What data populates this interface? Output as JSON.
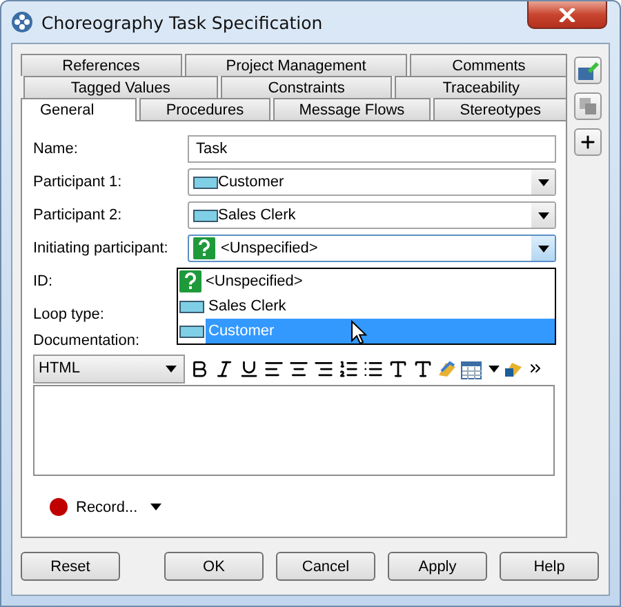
{
  "window": {
    "title": "Choreography Task Specification"
  },
  "tab_rows": [
    [
      {
        "label": "References",
        "selected": false
      },
      {
        "label": "Project Management",
        "selected": false
      },
      {
        "label": "Comments",
        "selected": false
      }
    ],
    [
      {
        "label": "Tagged Values",
        "selected": false
      },
      {
        "label": "Constraints",
        "selected": false
      },
      {
        "label": "Traceability",
        "selected": false
      }
    ],
    [
      {
        "label": "General",
        "selected": true
      },
      {
        "label": "Procedures",
        "selected": false
      },
      {
        "label": "Message Flows",
        "selected": false
      },
      {
        "label": "Stereotypes",
        "selected": false
      }
    ]
  ],
  "fields": [
    {
      "label": "Name:",
      "kind": "text",
      "value": "Task"
    },
    {
      "label": "Participant 1:",
      "kind": "participant",
      "value": "Customer",
      "focused": false
    },
    {
      "label": "Participant 2:",
      "kind": "participant",
      "value": "Sales Clerk",
      "focused": false
    },
    {
      "label": "Initiating participant:",
      "kind": "unspecified",
      "value": "<Unspecified>",
      "focused": true
    },
    {
      "label": "ID:",
      "kind": "covered"
    },
    {
      "label": "Loop type:",
      "kind": "covered"
    }
  ],
  "dropdown": [
    {
      "kind": "unspecified",
      "label": "<Unspecified>",
      "selected": false
    },
    {
      "kind": "participant",
      "label": "Sales Clerk",
      "selected": false
    },
    {
      "kind": "participant",
      "label": "Customer",
      "selected": true
    }
  ],
  "documentation": {
    "label": "Documentation:",
    "format": "HTML"
  },
  "record": {
    "label": "Record..."
  },
  "buttons": [
    {
      "label": "Reset",
      "kind": "left"
    },
    {
      "label": "OK",
      "kind": "right"
    },
    {
      "label": "Cancel",
      "kind": "right"
    },
    {
      "label": "Apply",
      "kind": "right"
    },
    {
      "label": "Help",
      "kind": "right"
    }
  ]
}
